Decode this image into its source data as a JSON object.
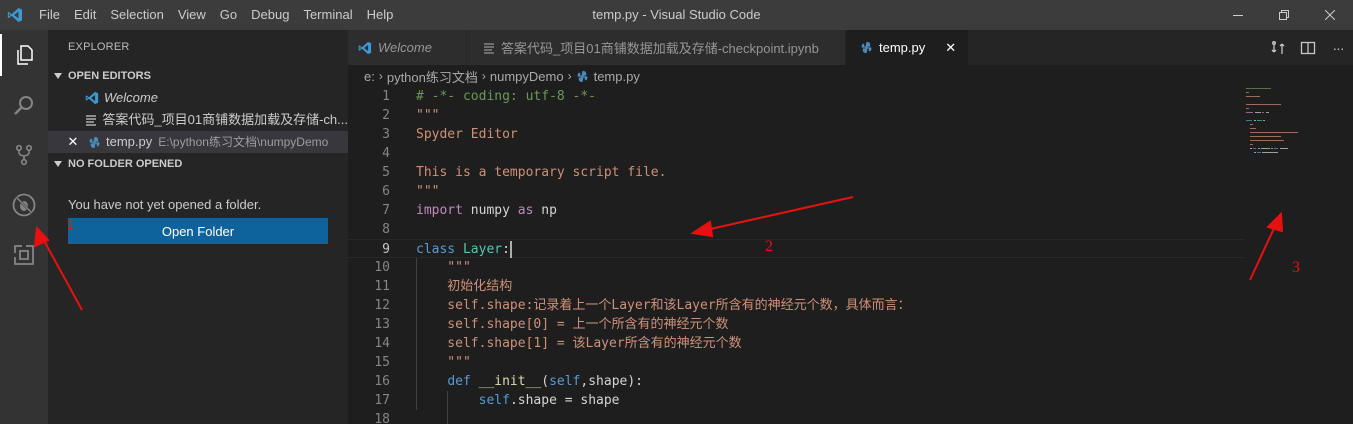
{
  "titlebar": {
    "title": "temp.py - Visual Studio Code",
    "menu": [
      "File",
      "Edit",
      "Selection",
      "View",
      "Go",
      "Debug",
      "Terminal",
      "Help"
    ]
  },
  "activitybar": {
    "items": [
      {
        "icon": "files-icon",
        "active": true
      },
      {
        "icon": "search-icon",
        "active": false
      },
      {
        "icon": "source-control-icon",
        "active": false
      },
      {
        "icon": "debug-icon",
        "active": false
      },
      {
        "icon": "extensions-icon",
        "active": false
      }
    ]
  },
  "sidebar": {
    "title": "EXPLORER",
    "open_editors_label": "OPEN EDITORS",
    "open_editors": [
      {
        "name": "Welcome",
        "icon": "vscode-icon",
        "italic": true,
        "desc": "",
        "close": "",
        "selected": false
      },
      {
        "name": "答案代码_项目01商铺数据加载及存储-ch...",
        "icon": "notebook-icon",
        "italic": false,
        "desc": "",
        "close": "",
        "selected": false
      },
      {
        "name": "temp.py",
        "icon": "python-icon",
        "italic": false,
        "desc": "E:\\python练习文档\\numpyDemo",
        "close": "✕",
        "selected": true
      }
    ],
    "no_folder_label": "NO FOLDER OPENED",
    "no_folder_text": "You have not yet opened a folder.",
    "open_folder_button": "Open Folder"
  },
  "tabs": [
    {
      "label": "Welcome",
      "icon": "vscode-icon",
      "active": false,
      "italic": true,
      "close": ""
    },
    {
      "label": "答案代码_项目01商铺数据加载及存储-checkpoint.ipynb",
      "icon": "notebook-icon",
      "active": false,
      "italic": false,
      "close": ""
    },
    {
      "label": "temp.py",
      "icon": "python-icon",
      "active": true,
      "italic": false,
      "close": "✕"
    }
  ],
  "tab_actions": [
    "compare-icon",
    "split-editor-icon",
    "more-icon"
  ],
  "tab_more": "···",
  "breadcrumb": [
    "e:",
    "python练习文档",
    "numpyDemo",
    "temp.py"
  ],
  "editor": {
    "current_line": 9,
    "lines": [
      {
        "n": "1",
        "tokens": [
          [
            "c-com",
            "# -*- coding: utf-8 -*-"
          ]
        ]
      },
      {
        "n": "2",
        "tokens": [
          [
            "c-str",
            "\"\"\""
          ]
        ]
      },
      {
        "n": "3",
        "tokens": [
          [
            "c-str",
            "Spyder Editor"
          ]
        ]
      },
      {
        "n": "4",
        "tokens": []
      },
      {
        "n": "5",
        "tokens": [
          [
            "c-str",
            "This is a temporary script file."
          ]
        ]
      },
      {
        "n": "6",
        "tokens": [
          [
            "c-str",
            "\"\"\""
          ]
        ]
      },
      {
        "n": "7",
        "tokens": [
          [
            "c-kw",
            "import"
          ],
          [
            "c-plain",
            " numpy "
          ],
          [
            "c-kw",
            "as"
          ],
          [
            "c-plain",
            " np"
          ]
        ]
      },
      {
        "n": "8",
        "tokens": []
      },
      {
        "n": "9",
        "tokens": [
          [
            "c-def",
            "class"
          ],
          [
            "c-plain",
            " "
          ],
          [
            "c-cls",
            "Layer"
          ],
          [
            "c-plain",
            ":"
          ]
        ]
      },
      {
        "n": "10",
        "tokens": [
          [
            "c-str",
            "    \"\"\""
          ]
        ]
      },
      {
        "n": "11",
        "tokens": [
          [
            "c-str",
            "    初始化结构"
          ]
        ]
      },
      {
        "n": "12",
        "tokens": [
          [
            "c-str",
            "    self.shape:记录着上一个Layer和该Layer所含有的神经元个数，具体而言："
          ]
        ]
      },
      {
        "n": "13",
        "tokens": [
          [
            "c-str",
            "    self.shape[0] = 上一个所含有的神经元个数"
          ]
        ]
      },
      {
        "n": "14",
        "tokens": [
          [
            "c-str",
            "    self.shape[1] = 该Layer所含有的神经元个数"
          ]
        ]
      },
      {
        "n": "15",
        "tokens": [
          [
            "c-str",
            "    \"\"\""
          ]
        ]
      },
      {
        "n": "16",
        "tokens": [
          [
            "c-plain",
            "    "
          ],
          [
            "c-def",
            "def"
          ],
          [
            "c-plain",
            " "
          ],
          [
            "c-fn",
            "__init__"
          ],
          [
            "c-plain",
            "("
          ],
          [
            "c-def",
            "self"
          ],
          [
            "c-plain",
            ",shape):"
          ]
        ]
      },
      {
        "n": "17",
        "tokens": [
          [
            "c-plain",
            "        "
          ],
          [
            "c-def",
            "self"
          ],
          [
            "c-plain",
            ".shape = shape"
          ]
        ]
      },
      {
        "n": "18",
        "tokens": []
      }
    ]
  },
  "annotations": [
    "1",
    "2",
    "3"
  ],
  "colors": {
    "accent": "#0e639c",
    "annotation": "#e81010",
    "titlebar": "#3c3c3c",
    "activitybar": "#333333",
    "sidebar": "#252526",
    "editor": "#1e1e1e"
  }
}
